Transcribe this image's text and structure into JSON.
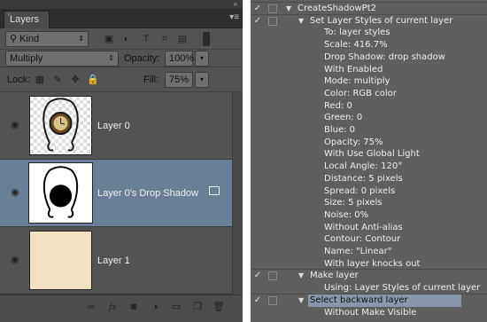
{
  "layers_panel": {
    "tab_label": "Layers",
    "kind_label": "Kind",
    "blend_mode": "Multiply",
    "opacity_label": "Opacity:",
    "opacity_value": "100%",
    "lock_label": "Lock:",
    "fill_label": "Fill:",
    "fill_value": "75%",
    "layers": [
      {
        "name": "Layer 0",
        "selected": false
      },
      {
        "name": "Layer 0's Drop Shadow",
        "selected": true
      },
      {
        "name": "Layer 1",
        "selected": false
      }
    ],
    "bottom_icons": [
      "link-icon",
      "fx-icon",
      "mask-icon",
      "adjustment-icon",
      "folder-icon",
      "new-layer-icon",
      "trash-icon"
    ]
  },
  "actions_panel": {
    "items": [
      {
        "text": "CreateShadowPt2",
        "level": 0,
        "check": "✓",
        "expanded": true
      },
      {
        "text": "Set Layer Styles of current layer",
        "level": 1,
        "check": "✓",
        "expanded": true
      },
      {
        "text": "To: layer styles",
        "level": 2
      },
      {
        "text": "Scale: 416.7%",
        "level": 2
      },
      {
        "text": "Drop Shadow: drop shadow",
        "level": 2
      },
      {
        "text": "With Enabled",
        "level": 2
      },
      {
        "text": "Mode: multiply",
        "level": 2
      },
      {
        "text": "Color: RGB color",
        "level": 2
      },
      {
        "text": "Red: 0",
        "level": 2
      },
      {
        "text": "Green: 0",
        "level": 2
      },
      {
        "text": "Blue: 0",
        "level": 2
      },
      {
        "text": "Opacity: 75%",
        "level": 2
      },
      {
        "text": "With Use Global Light",
        "level": 2
      },
      {
        "text": "Local Angle: 120°",
        "level": 2
      },
      {
        "text": "Distance: 5 pixels",
        "level": 2
      },
      {
        "text": "Spread: 0 pixels",
        "level": 2
      },
      {
        "text": "Size: 5 pixels",
        "level": 2
      },
      {
        "text": "Noise: 0%",
        "level": 2
      },
      {
        "text": "Without Anti-alias",
        "level": 2
      },
      {
        "text": "Contour: Contour",
        "level": 2
      },
      {
        "text": "Name:  \"Linear\"",
        "level": 2
      },
      {
        "text": "With layer knocks out",
        "level": 2
      },
      {
        "text": "Make layer",
        "level": 1,
        "check": "✓",
        "expanded": true
      },
      {
        "text": "Using: Layer Styles of current layer",
        "level": 2
      },
      {
        "text": "Select backward layer",
        "level": 1,
        "check": "✓",
        "expanded": true,
        "highlight": true
      },
      {
        "text": "Without Make Visible",
        "level": 2
      }
    ]
  }
}
